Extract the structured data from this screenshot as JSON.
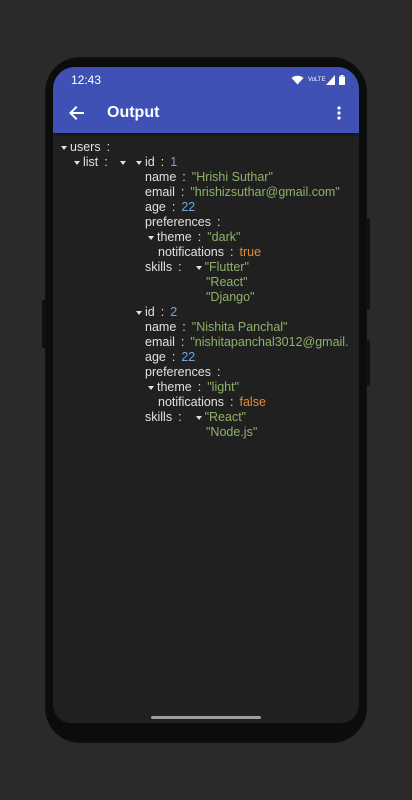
{
  "status_bar": {
    "time": "12:43",
    "network_label": "VoLTE"
  },
  "app_bar": {
    "title": "Output"
  },
  "json": {
    "root_key": "users",
    "list_key": "list",
    "sep": ":",
    "user1": {
      "id_key": "id",
      "id": "1",
      "name_key": "name",
      "name": "\"Hrishi Suthar\"",
      "email_key": "email",
      "email": "\"hrishizsuthar@gmail.com\"",
      "age_key": "age",
      "age": "22",
      "preferences_key": "preferences",
      "theme_key": "theme",
      "theme": "\"dark\"",
      "notifications_key": "notifications",
      "notifications": "true",
      "skills_key": "skills",
      "skills": [
        "\"Flutter\"",
        "\"React\"",
        "\"Django\""
      ]
    },
    "user2": {
      "id_key": "id",
      "id": "2",
      "name_key": "name",
      "name": "\"Nishita Panchal\"",
      "email_key": "email",
      "email": "\"nishitapanchal3012@gmail.",
      "age_key": "age",
      "age": "22",
      "preferences_key": "preferences",
      "theme_key": "theme",
      "theme": "\"light\"",
      "notifications_key": "notifications",
      "notifications": "false",
      "skills_key": "skills",
      "skills": [
        "\"React\"",
        "\"Node.js\""
      ]
    }
  },
  "colors": {
    "app_bar": "#3f51b5",
    "background": "#202020",
    "string": "#8fb26a",
    "number": "#6fa8dc",
    "boolean": "#e08c3a"
  }
}
